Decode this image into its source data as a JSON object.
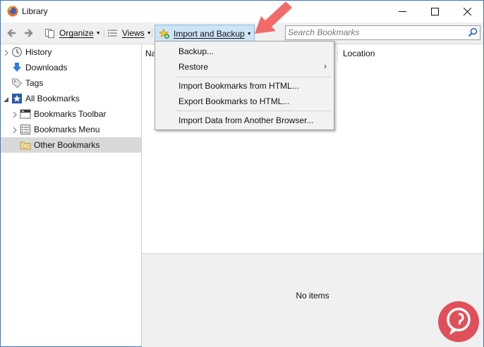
{
  "window": {
    "title": "Library"
  },
  "toolbar": {
    "organize_label": "Organize",
    "views_label": "Views",
    "import_backup_label": "Import and Backup"
  },
  "search": {
    "placeholder": "Search Bookmarks"
  },
  "sidebar": {
    "items": [
      {
        "label": "History"
      },
      {
        "label": "Downloads"
      },
      {
        "label": "Tags"
      },
      {
        "label": "All Bookmarks"
      },
      {
        "label": "Bookmarks Toolbar"
      },
      {
        "label": "Bookmarks Menu"
      },
      {
        "label": "Other Bookmarks"
      }
    ]
  },
  "columns": {
    "name": "Na",
    "location": "Location"
  },
  "details": {
    "empty_text": "No items"
  },
  "menu": {
    "items": [
      {
        "label": "Backup..."
      },
      {
        "label": "Restore"
      },
      {
        "label": "Import Bookmarks from HTML..."
      },
      {
        "label": "Export Bookmarks to HTML..."
      },
      {
        "label": "Import Data from Another Browser..."
      }
    ]
  },
  "colors": {
    "selection": "#d9d9d9",
    "accent_button": "#cde4f7",
    "annotation_arrow": "#f26b6b",
    "watermark": "#e0505a"
  }
}
